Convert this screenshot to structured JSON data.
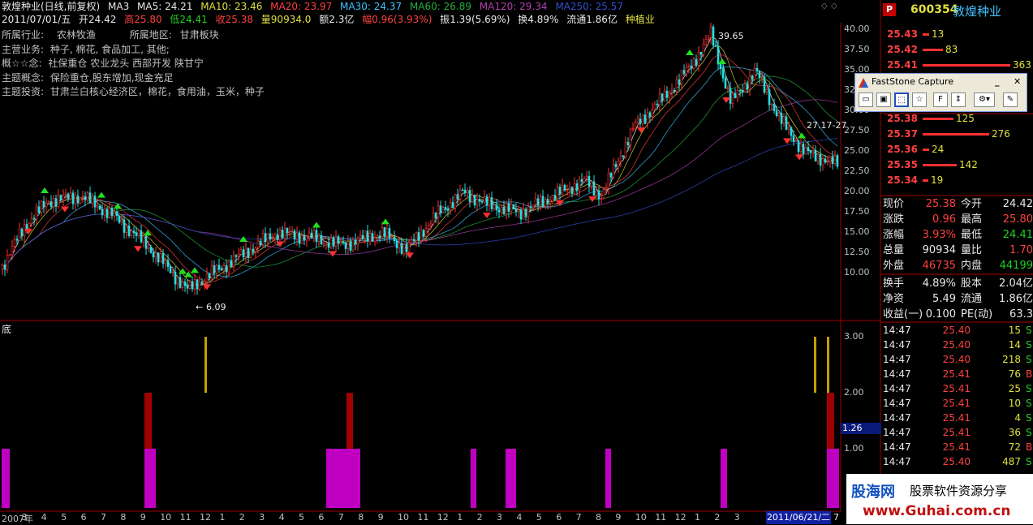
{
  "header": {
    "title": "敦煌种业(日线,前复权)",
    "ma_label": "MA3",
    "ma5": "MA5: 24.21",
    "ma10": "MA10: 23.46",
    "ma20": "MA20: 23.97",
    "ma30": "MA30: 24.37",
    "ma60": "MA60: 26.89",
    "ma120": "MA120: 29.34",
    "ma250": "MA250: 25.57"
  },
  "day_line": {
    "date": "2011/07/01/五",
    "open": "开24.42",
    "high": "高25.80",
    "low": "低24.41",
    "close": "收25.38",
    "vol": "量90934.0",
    "amount": "额2.3亿",
    "change": "幅0.96(3.93%)",
    "amplitude": "振1.39(5.69%)",
    "turnover": "换4.89%",
    "float": "流通1.86亿",
    "sector": "种植业"
  },
  "info": [
    {
      "k": "所属行业:",
      "v": "农林牧渔",
      "k2": "所属地区:",
      "v2": "甘肃板块"
    },
    {
      "k": "主营业务:",
      "v": "种子, 棉花, 食品加工, 其他;"
    },
    {
      "k": "概☆☆念:",
      "v": "社保重仓 农业龙头 西部开发 陕甘宁"
    },
    {
      "k": "主题概念:",
      "v": "保险重仓,股东增加,现金充足"
    },
    {
      "k": "主题投资:",
      "v": "甘肃兰白核心经济区，棉花，食用油，玉米，种子"
    }
  ],
  "annotations": {
    "high": "39.65",
    "low": "6.09",
    "cross": "27.17-27",
    "indicator_value": "1.26"
  },
  "price_axis": [
    "40.00",
    "37.50",
    "35.00",
    "32.50",
    "30.00",
    "27.50",
    "25.00",
    "22.50",
    "20.00",
    "17.50",
    "15.00",
    "12.50",
    "10.00"
  ],
  "ind_axis": [
    "3.00",
    "2.00",
    "1.00"
  ],
  "ind_label": "底",
  "months": [
    "2007年",
    "3",
    "4",
    "5",
    "6",
    "7",
    "8",
    "9",
    "10",
    "11",
    "12",
    "1",
    "2",
    "3",
    "4",
    "5",
    "6",
    "7",
    "8",
    "9",
    "10",
    "11",
    "12",
    "1",
    "2",
    "3",
    "4",
    "5",
    "6",
    "7",
    "8",
    "9",
    "10",
    "11",
    "12",
    "1",
    "2",
    "3"
  ],
  "date_box": "2011/06/21/二",
  "date_box_end": "7",
  "stock": {
    "code": "600354",
    "name": "敦煌种业",
    "badge": "P"
  },
  "ask": [
    {
      "p": "25.43",
      "q": "13",
      "w": 8
    },
    {
      "p": "25.42",
      "q": "83",
      "w": 25
    },
    {
      "p": "25.41",
      "q": "363",
      "w": 108
    }
  ],
  "bid": [
    {
      "p": "25.38",
      "q": "125",
      "w": 38
    },
    {
      "p": "25.37",
      "q": "276",
      "w": 82
    },
    {
      "p": "25.36",
      "q": "24",
      "w": 8
    },
    {
      "p": "25.35",
      "q": "142",
      "w": 42
    },
    {
      "p": "25.34",
      "q": "19",
      "w": 7
    }
  ],
  "stats": [
    {
      "l1": "现价",
      "v1": "25.38",
      "c1": "red",
      "l2": "今开",
      "v2": "24.42",
      "c2": "white"
    },
    {
      "l1": "涨跌",
      "v1": "0.96",
      "c1": "red",
      "l2": "最高",
      "v2": "25.80",
      "c2": "red"
    },
    {
      "l1": "涨幅",
      "v1": "3.93%",
      "c1": "red",
      "l2": "最低",
      "v2": "24.41",
      "c2": "green"
    },
    {
      "l1": "总量",
      "v1": "90934",
      "c1": "white",
      "l2": "量比",
      "v2": "1.70",
      "c2": "red"
    },
    {
      "l1": "外盘",
      "v1": "46735",
      "c1": "red",
      "l2": "内盘",
      "v2": "44199",
      "c2": "green"
    },
    {
      "l1": "换手",
      "v1": "4.89%",
      "c1": "white",
      "l2": "股本",
      "v2": "2.04亿",
      "c2": "white"
    },
    {
      "l1": "净资",
      "v1": "5.49",
      "c1": "white",
      "l2": "流通",
      "v2": "1.86亿",
      "c2": "white"
    },
    {
      "l1": "收益(一)",
      "v1": "0.100",
      "c1": "white",
      "l2": "PE(动)",
      "v2": "63.3",
      "c2": "white"
    }
  ],
  "trades": [
    {
      "t": "14:47",
      "p": "25.40",
      "q": "15",
      "s": "S"
    },
    {
      "t": "14:47",
      "p": "25.40",
      "q": "14",
      "s": "S"
    },
    {
      "t": "14:47",
      "p": "25.40",
      "q": "218",
      "s": "S"
    },
    {
      "t": "14:47",
      "p": "25.41",
      "q": "76",
      "s": "B"
    },
    {
      "t": "14:47",
      "p": "25.41",
      "q": "25",
      "s": "S"
    },
    {
      "t": "14:47",
      "p": "25.41",
      "q": "10",
      "s": "S"
    },
    {
      "t": "14:47",
      "p": "25.41",
      "q": "4",
      "s": "S"
    },
    {
      "t": "14:47",
      "p": "25.41",
      "q": "36",
      "s": "S"
    },
    {
      "t": "14:47",
      "p": "25.41",
      "q": "72",
      "s": "B"
    },
    {
      "t": "14:47",
      "p": "25.40",
      "q": "487",
      "s": "S"
    }
  ],
  "fsc": {
    "title": "FastStone Capture"
  },
  "watermark": {
    "brand": "股海网",
    "slogan": "股票软件资源分享",
    "url": "www.Guhai.com.cn"
  }
}
